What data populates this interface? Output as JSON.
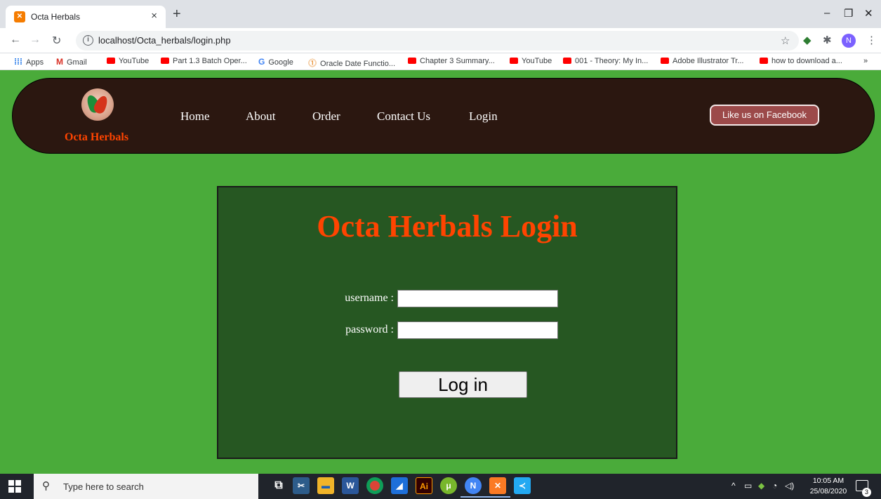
{
  "browser": {
    "tab_title": "Octa Herbals",
    "tab_favicon": "xampp-icon",
    "close_glyph": "×",
    "new_tab_glyph": "+",
    "url": "localhost/Octa_herbals/login.php",
    "profile_initial": "N",
    "window_controls": [
      "–",
      "❐",
      "✕"
    ],
    "bookmarks": [
      {
        "label": "Apps",
        "icon": "apps-grid-icon"
      },
      {
        "label": "Gmail",
        "icon": "gmail-icon"
      },
      {
        "label": "YouTube",
        "icon": "youtube-icon"
      },
      {
        "label": "Part 1.3 Batch Oper...",
        "icon": "youtube-icon"
      },
      {
        "label": "Google",
        "icon": "google-icon"
      },
      {
        "label": "Oracle Date Functio...",
        "icon": "oracle-icon"
      },
      {
        "label": "Chapter 3 Summary...",
        "icon": "youtube-icon"
      },
      {
        "label": "YouTube",
        "icon": "youtube-icon"
      },
      {
        "label": "001 - Theory: My In...",
        "icon": "youtube-icon"
      },
      {
        "label": "Adobe Illustrator Tr...",
        "icon": "youtube-icon"
      },
      {
        "label": "how to download a...",
        "icon": "youtube-icon"
      }
    ],
    "bookmarks_overflow": "»"
  },
  "site": {
    "brand": "Octa Herbals",
    "nav": [
      "Home",
      "About",
      "Order",
      "Contact Us",
      "Login"
    ],
    "facebook_button": "Like us on Facebook",
    "colors": {
      "page_bg": "#4aab3a",
      "nav_bg": "#2b1710",
      "accent": "#ff4400",
      "panel_bg": "#265722"
    }
  },
  "login": {
    "title": "Octa Herbals Login",
    "username_label": "username :",
    "username_value": "",
    "password_label": "password :",
    "password_value": "",
    "submit_label": "Log in"
  },
  "taskbar": {
    "search_placeholder": "Type here to search",
    "apps": [
      "task-view-icon",
      "snipping-tool-icon",
      "file-explorer-icon",
      "word-icon",
      "chrome-icon",
      "edge-icon",
      "illustrator-icon",
      "utorrent-icon",
      "chrome-profile-icon",
      "xampp-icon",
      "vscode-icon"
    ],
    "time": "10:05 AM",
    "date": "25/08/2020",
    "notification_count": "3"
  }
}
